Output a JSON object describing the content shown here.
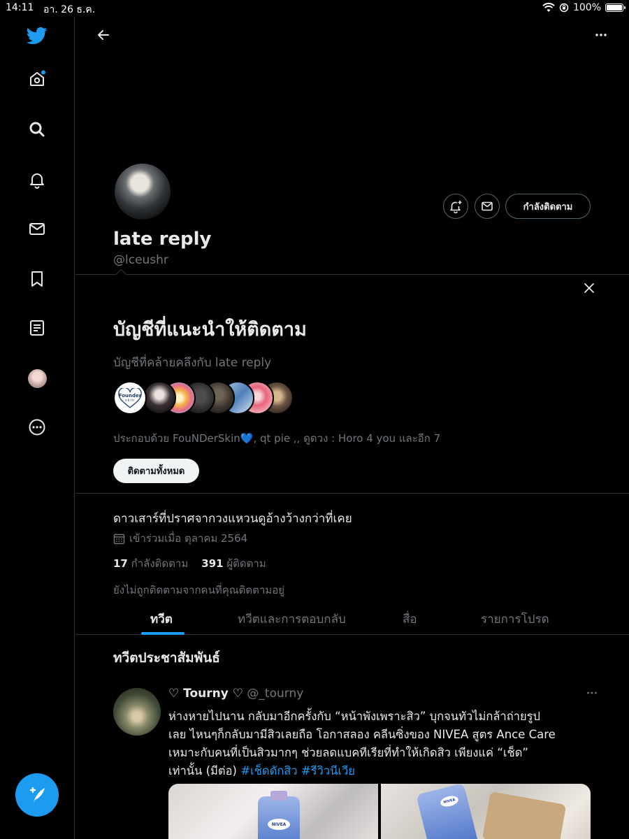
{
  "status_bar": {
    "time": "14:11",
    "date": "อา. 26 ธ.ค.",
    "battery": "100%"
  },
  "colors": {
    "accent": "#1d9bf0",
    "background": "#000000",
    "text": "#e7e9ea",
    "muted": "#71767b",
    "border": "#2f3336"
  },
  "sidebar": {
    "items": [
      {
        "name": "twitter-logo-icon"
      },
      {
        "name": "home-icon",
        "has_notification_dot": true
      },
      {
        "name": "search-icon"
      },
      {
        "name": "notifications-icon"
      },
      {
        "name": "messages-icon"
      },
      {
        "name": "bookmarks-icon"
      },
      {
        "name": "lists-icon"
      },
      {
        "name": "profile-avatar"
      },
      {
        "name": "more-icon"
      }
    ],
    "compose": "compose-tweet-icon"
  },
  "profile": {
    "name": "late reply",
    "handle": "@lceushr",
    "following_button": "กำลังติดตาม",
    "bio": "ดาวเสาร์ที่ปราศจากวงแหวนดูอ้างว้างกว่าที่เคย",
    "joined": "เข้าร่วมเมื่อ ตุลาคม 2564",
    "following_count": "17",
    "following_label": "กำลังติดตาม",
    "followers_count": "391",
    "followers_label": "ผู้ติดตาม",
    "not_followed_notice": "ยังไม่ถูกติดตามจากคนที่คุณติดตามอยู่"
  },
  "suggestions": {
    "title": "บัญชีที่แนะนำให้ติดตาม",
    "subtitle": "บัญชีที่คล้ายคลึงกับ late reply",
    "description": "ประกอบด้วย FouNDerSkin💙, qt pie ,, ดูดวง : Horo 4 you และอีก 7",
    "follow_all": "ติดตามทั้งหมด",
    "avatar_texts": {
      "founder_top": "Founder",
      "founder_bottom": "skin"
    }
  },
  "tabs": [
    {
      "label": "ทวีต",
      "active": true
    },
    {
      "label": "ทวีตและการตอบกลับ",
      "active": false
    },
    {
      "label": "สื่อ",
      "active": false
    },
    {
      "label": "รายการโปรด",
      "active": false
    }
  ],
  "promoted": {
    "title": "ทวีตประชาสัมพันธ์",
    "tweet": {
      "name": "♡ Tourny ♡",
      "handle": "@_tourny",
      "text_line1": "ห่างหายไปนาน กลับมาอีกครั้งกับ “หน้าพังเพราะสิว” บุกจนทัวไม่กล้าถ่ายรูป",
      "text_line2": "เลย ไหนๆก็กลับมามีสิวเลยถือ โอกาสลอง คลีนซิ่งของ NIVEA สูตร Ance Care",
      "text_line3": "เหมาะกับคนที่เป็นสิวมากๆ ช่วยลดแบคทีเรียที่ทำให้เกิดสิว เพียงแค่ “เช็ด”",
      "text_line4": "เท่านั้น (มีต่อ)",
      "hashtag1": "#เช็ดดักสิว",
      "hashtag2": "#รีวิวนีเวีย",
      "brand_label": "NIVEA"
    }
  }
}
